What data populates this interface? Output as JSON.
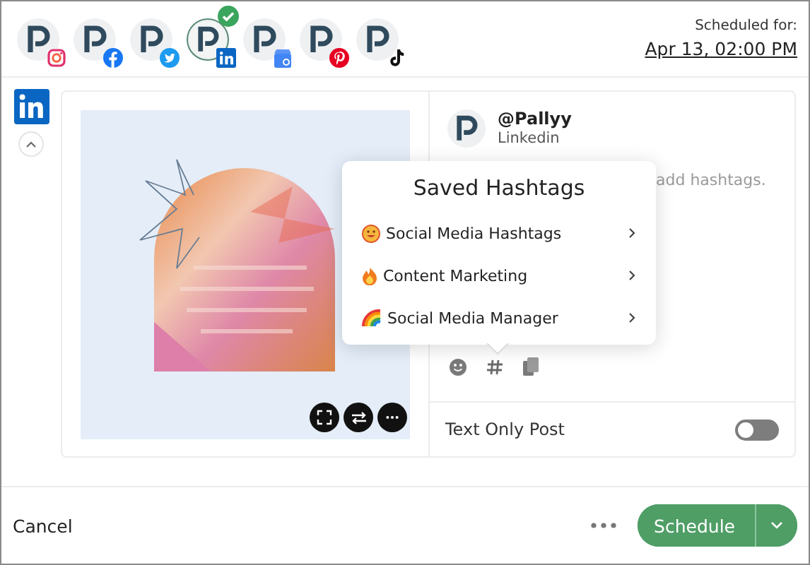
{
  "accounts": [
    {
      "kind": "instagram",
      "selected": false
    },
    {
      "kind": "facebook",
      "selected": false
    },
    {
      "kind": "twitter",
      "selected": false
    },
    {
      "kind": "linkedin",
      "selected": true
    },
    {
      "kind": "google",
      "selected": false
    },
    {
      "kind": "pinterest",
      "selected": false
    },
    {
      "kind": "tiktok",
      "selected": false
    }
  ],
  "schedule": {
    "label": "Scheduled for:",
    "date": "Apr 13, 02:00 PM"
  },
  "channel": {
    "kind": "linkedin"
  },
  "post": {
    "account_name": "@Pallyy",
    "account_network": "Linkedin",
    "placeholder": "add hashtags.",
    "text_only": {
      "label": "Text Only Post",
      "on": false
    }
  },
  "hashtag_popup": {
    "title": "Saved Hashtags",
    "items": [
      {
        "kind": "face",
        "label": "Social Media Hashtags"
      },
      {
        "kind": "flame",
        "label": "Content Marketing"
      },
      {
        "kind": "rainbow",
        "label": "Social Media Manager"
      }
    ]
  },
  "footer": {
    "cancel": "Cancel",
    "schedule": "Schedule"
  }
}
